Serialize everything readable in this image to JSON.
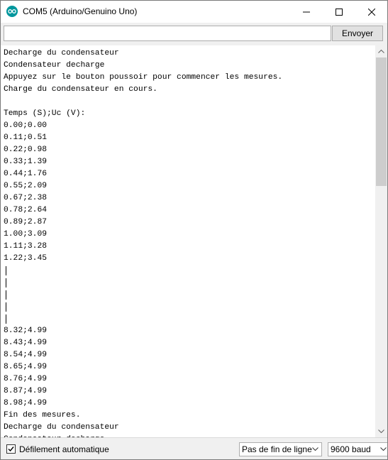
{
  "window": {
    "title": "COM5 (Arduino/Genuino Uno)",
    "app_icon": "arduino-logo-icon",
    "controls": [
      "minimize-icon",
      "maximize-icon",
      "close-icon"
    ]
  },
  "toolbar": {
    "input_value": "",
    "send_label": "Envoyer"
  },
  "output_lines": [
    "Decharge du condensateur",
    "Condensateur decharge",
    "Appuyez sur le bouton poussoir pour commencer les mesures.",
    "Charge du condensateur en cours.",
    "",
    "Temps (S);Uc (V):",
    "0.00;0.00",
    "0.11;0.51",
    "0.22;0.98",
    "0.33;1.39",
    "0.44;1.76",
    "0.55;2.09",
    "0.67;2.38",
    "0.78;2.64",
    "0.89;2.87",
    "1.00;3.09",
    "1.11;3.28",
    "1.22;3.45",
    "|",
    "|",
    "|",
    "|",
    "|",
    "8.32;4.99",
    "8.43;4.99",
    "8.54;4.99",
    "8.65;4.99",
    "8.76;4.99",
    "8.87;4.99",
    "8.98;4.99",
    "Fin des mesures.",
    "Decharge du condensateur",
    "Condensateur decharge"
  ],
  "scrollbar": {
    "up_icon": "scroll-up-arrow-icon",
    "down_icon": "scroll-down-arrow-icon"
  },
  "footer": {
    "autoscroll_label": "Défilement automatique",
    "autoscroll_checked": true,
    "line_ending_value": "Pas de fin de ligne",
    "baud_value": "9600 baud"
  }
}
